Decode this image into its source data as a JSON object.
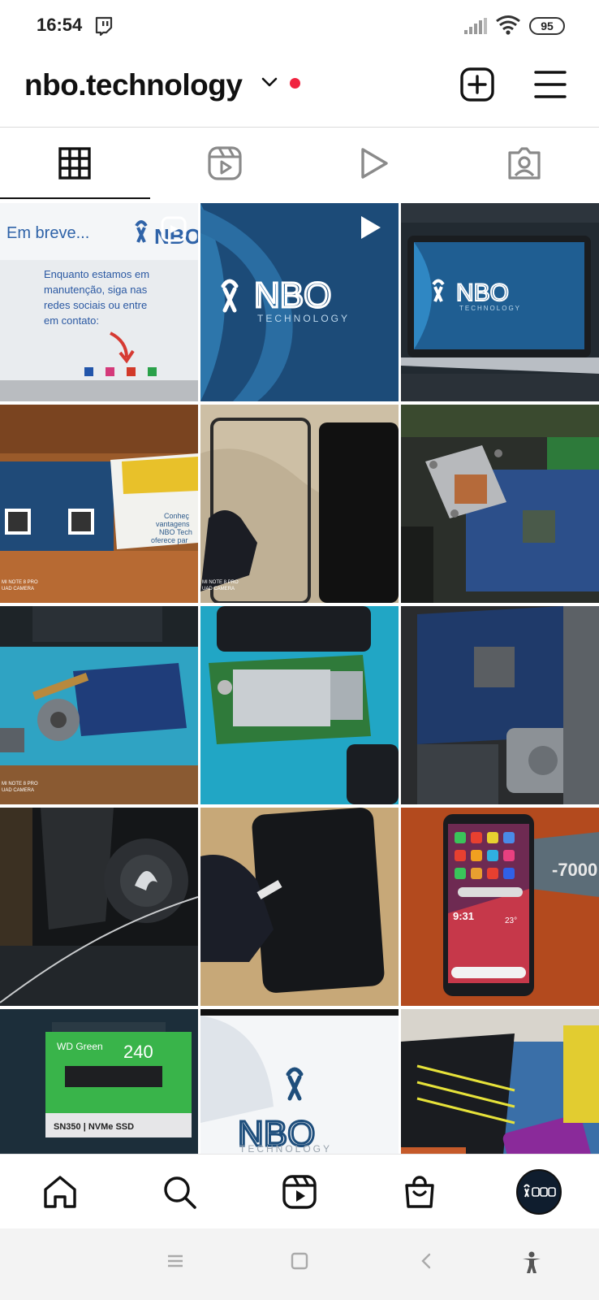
{
  "status_bar": {
    "time": "16:54",
    "battery": "95"
  },
  "header": {
    "username": "nbo.technology"
  },
  "tabs": [
    {
      "name": "grid-tab",
      "icon": "grid-icon",
      "active": true
    },
    {
      "name": "reels-tab",
      "icon": "reels-icon",
      "active": false
    },
    {
      "name": "videos-tab",
      "icon": "play-icon",
      "active": false
    },
    {
      "name": "tagged-tab",
      "icon": "tagged-person-icon",
      "active": false
    }
  ],
  "posts": {
    "p1_heading": "Em breve...",
    "p1_body": [
      "Enquanto estamos em",
      "manutenção, siga nas",
      "redes sociais ou entre",
      "em contato:"
    ],
    "logo_text": "NBO",
    "logo_sub": "TECHNOLOGY",
    "p4_text": [
      "Conheç",
      "vantagens",
      "NBO Tech",
      "oferece par"
    ],
    "camera_tag": [
      "MI NOTE 8 PRO",
      "UAD CAMERA"
    ],
    "p12_battery": "-7000",
    "p12_time": "9:31",
    "p12_temp": "23°",
    "p13_brand": "WD Green",
    "p13_capacity": "240",
    "p13_model": "SN350 | NVMe SSD"
  },
  "colors": {
    "accent_red": "#f0233f",
    "nbo_blue": "#1e4e7c",
    "nbo_light": "#3aa0d8"
  }
}
